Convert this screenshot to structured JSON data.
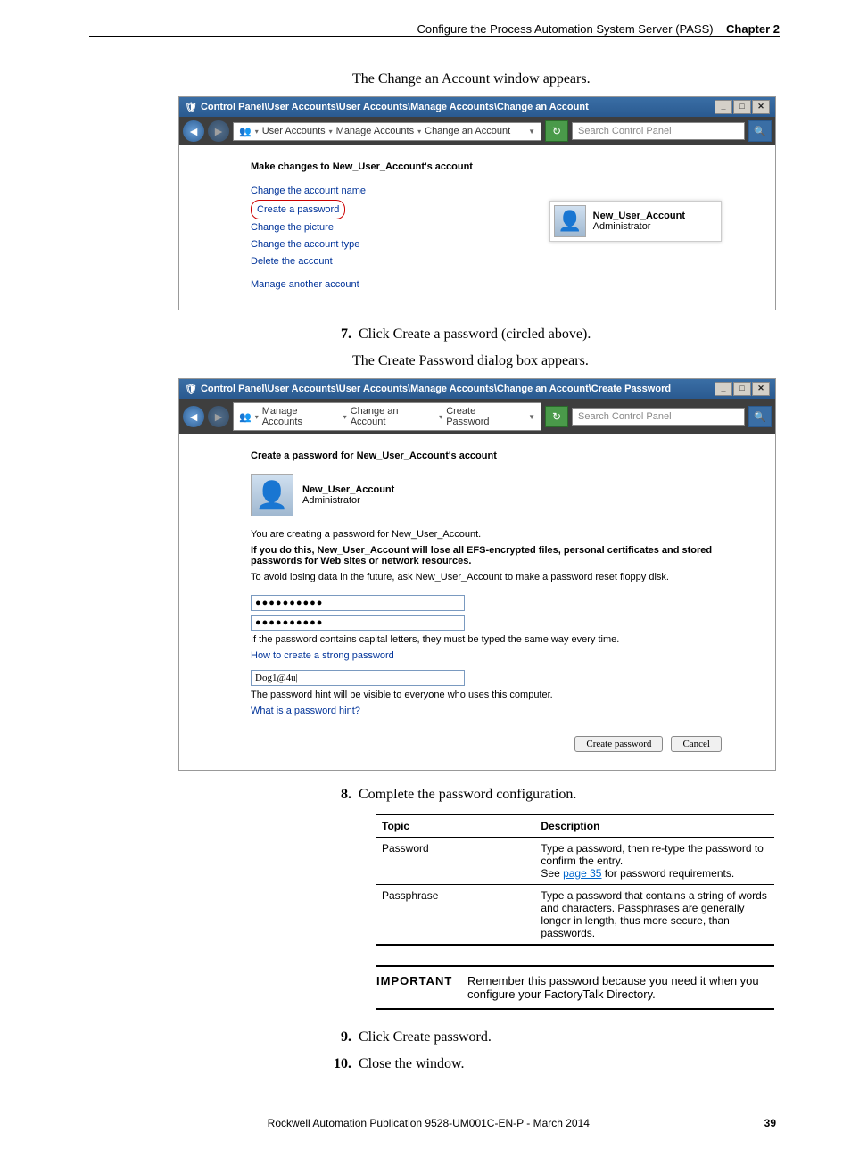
{
  "header": {
    "section": "Configure the Process Automation System Server (PASS)",
    "chapter": "Chapter 2"
  },
  "intro1": "The Change an Account window appears.",
  "screenshot1": {
    "title": "Control Panel\\User Accounts\\User Accounts\\Manage Accounts\\Change an Account",
    "breadcrumb": [
      "User Accounts",
      "Manage Accounts",
      "Change an Account"
    ],
    "search_placeholder": "Search Control Panel",
    "heading": "Make changes to New_User_Account's account",
    "links": [
      "Change the account name",
      "Create a password",
      "Change the picture",
      "Change the account type",
      "Delete the account",
      "Manage another account"
    ],
    "circled_index": 1,
    "user_name": "New_User_Account",
    "user_role": "Administrator"
  },
  "step7": "Click Create a password (circled above).",
  "intro2": "The Create Password dialog box appears.",
  "screenshot2": {
    "title": "Control Panel\\User Accounts\\User Accounts\\Manage Accounts\\Change an Account\\Create Password",
    "breadcrumb": [
      "Manage Accounts",
      "Change an Account",
      "Create Password"
    ],
    "search_placeholder": "Search Control Panel",
    "heading": "Create a password for New_User_Account's account",
    "user_name": "New_User_Account",
    "user_role": "Administrator",
    "line1": "You are creating a password for New_User_Account.",
    "line2": "If you do this, New_User_Account will lose all EFS-encrypted files, personal certificates and stored passwords for Web sites or network resources.",
    "line3": "To avoid losing data in the future, ask New_User_Account to make a password reset floppy disk.",
    "pw1": "●●●●●●●●●●",
    "pw2": "●●●●●●●●●●",
    "caps_note": "If the password contains capital letters, they must be typed the same way every time.",
    "strong_link": "How to create a strong password",
    "hint_value": "Dog1@4u|",
    "hint_note": "The password hint will be visible to everyone who uses this computer.",
    "hint_link": "What is a password hint?",
    "btn_create": "Create password",
    "btn_cancel": "Cancel"
  },
  "step8": "Complete the password configuration.",
  "table": {
    "h1": "Topic",
    "h2": "Description",
    "rows": [
      {
        "topic": "Password",
        "desc_a": "Type a password, then re-type the password to confirm the entry.",
        "desc_b_pre": "See ",
        "desc_b_link": "page 35",
        "desc_b_post": " for password requirements."
      },
      {
        "topic": "Passphrase",
        "desc_a": "Type a password that contains a string of words and characters. Passphrases are generally longer in length, thus more secure, than passwords."
      }
    ]
  },
  "important": {
    "label": "IMPORTANT",
    "text": "Remember this password because you need it when you configure your FactoryTalk Directory."
  },
  "step9": "Click Create password.",
  "step10": "Close the window.",
  "footer": {
    "pub": "Rockwell Automation Publication 9528-UM001C-EN-P - March 2014",
    "page": "39"
  }
}
